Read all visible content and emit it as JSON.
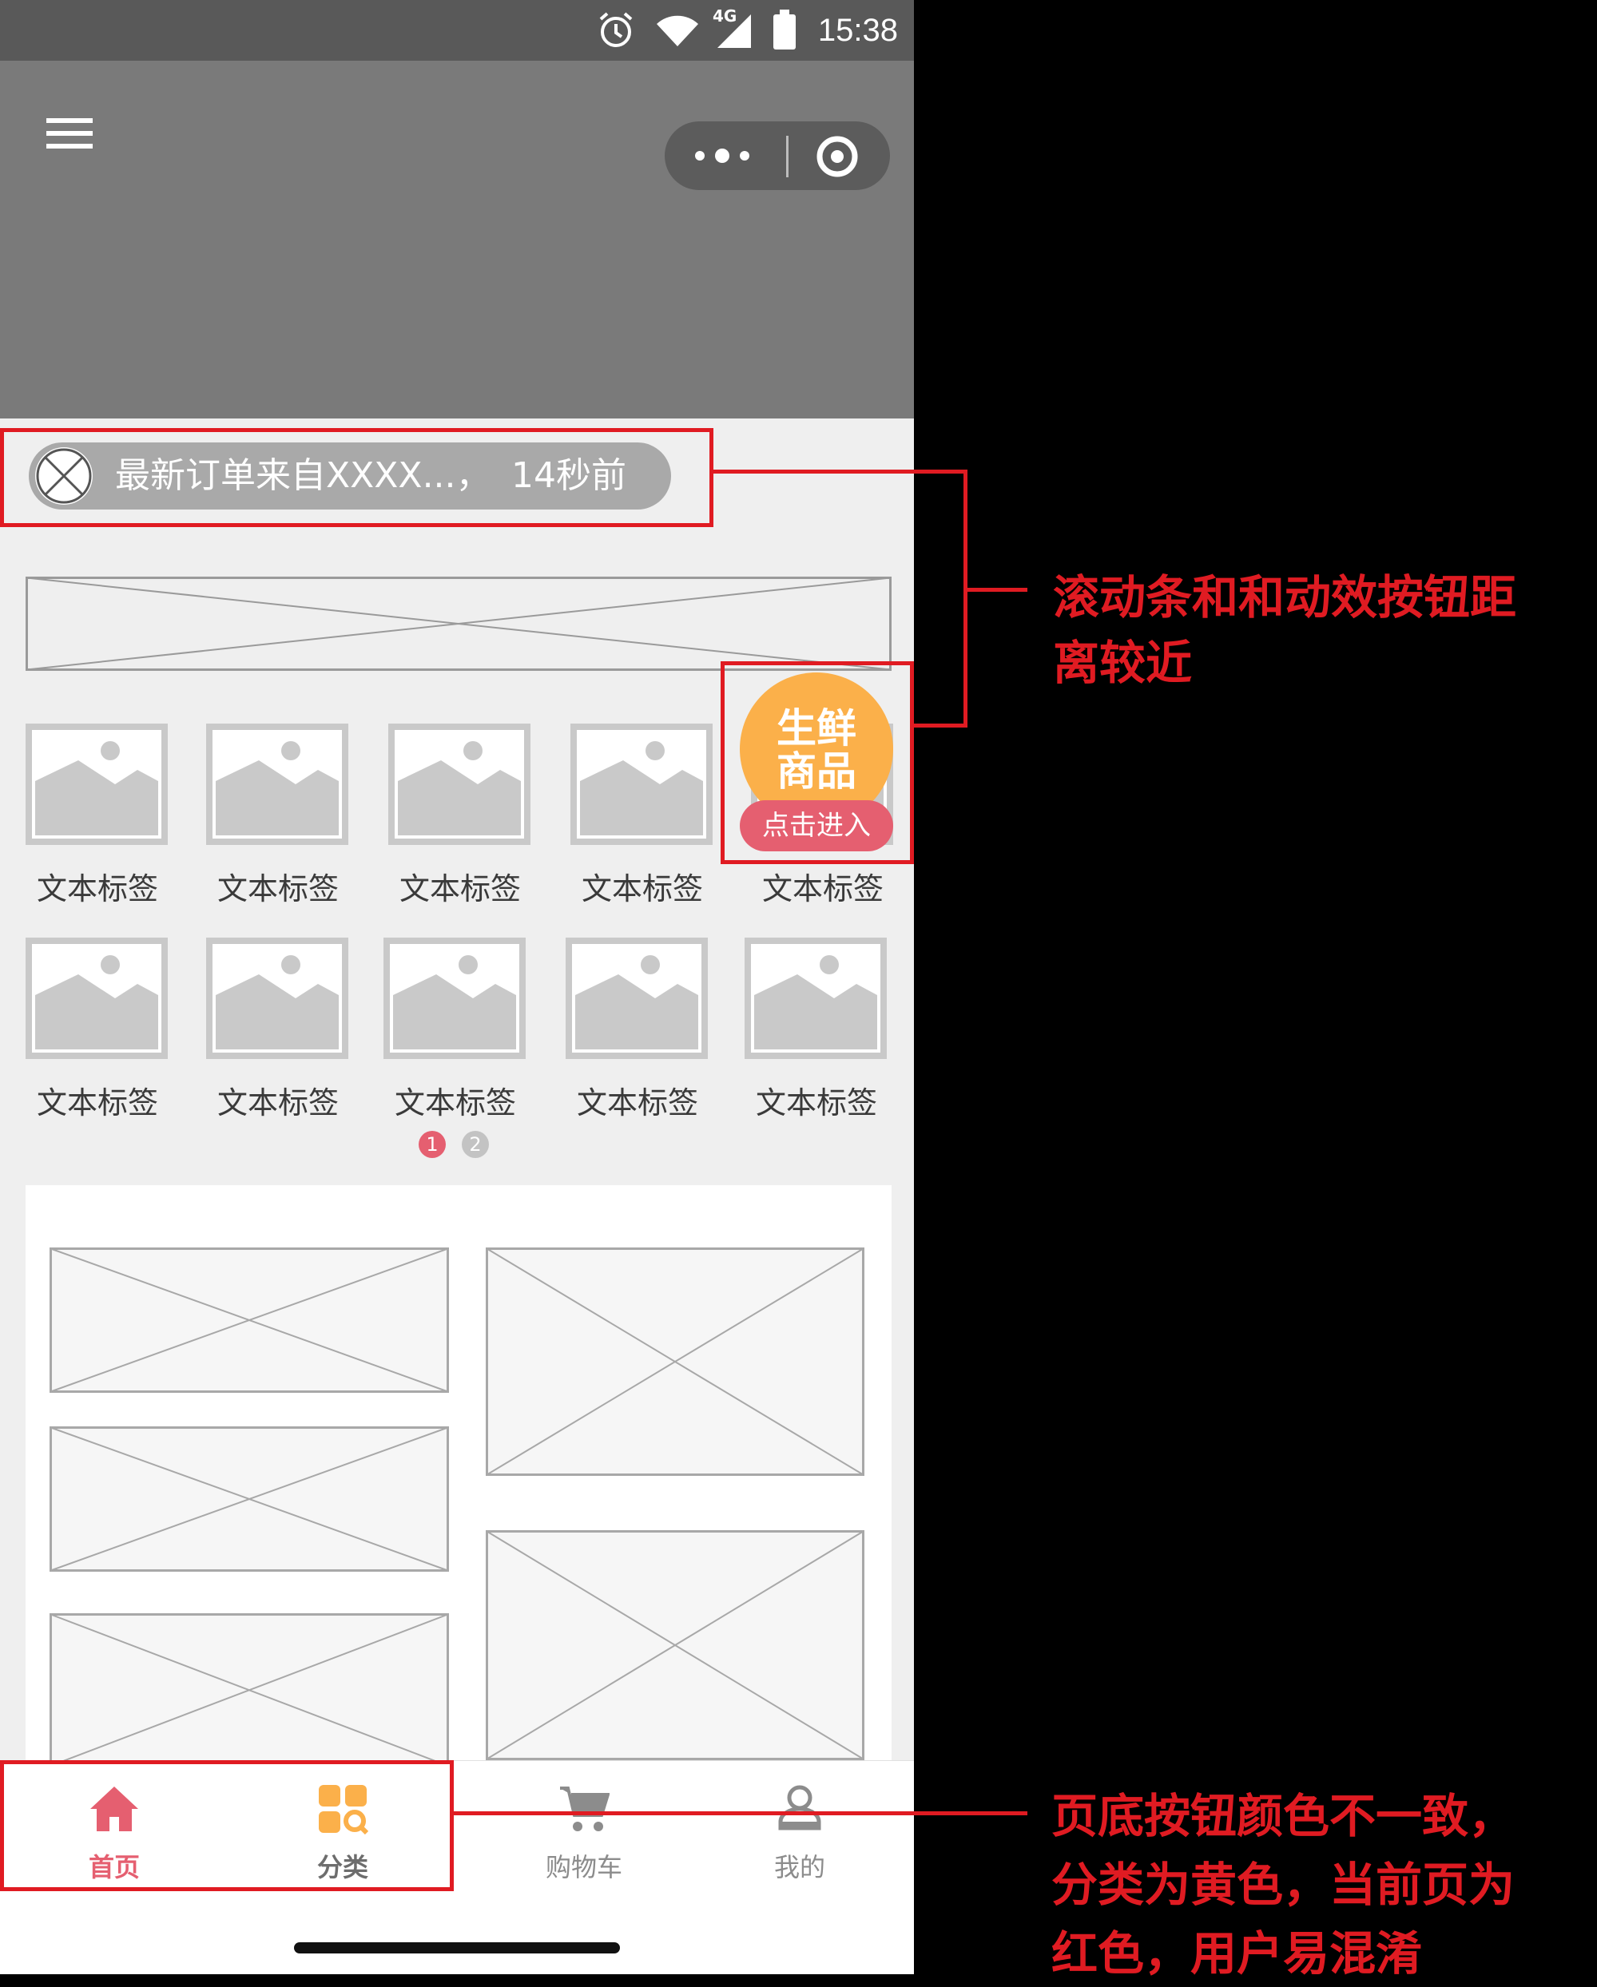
{
  "status_bar": {
    "time": "15:38",
    "network_label": "4G",
    "icons": [
      "alarm-icon",
      "wifi-icon",
      "signal-icon",
      "battery-icon"
    ]
  },
  "header": {
    "menu_icon": "hamburger-icon",
    "capsule_icons": [
      "more-dots-icon",
      "target-circle-icon"
    ]
  },
  "notice": {
    "text": "最新订单来自XXXX...，",
    "time": "14秒前"
  },
  "grid": {
    "row1": [
      "文本标签",
      "文本标签",
      "文本标签",
      "文本标签",
      "文本标签"
    ],
    "row2": [
      "文本标签",
      "文本标签",
      "文本标签",
      "文本标签",
      "文本标签"
    ]
  },
  "pagination": {
    "pages": [
      "1",
      "2"
    ],
    "current": "1"
  },
  "fab": {
    "title_line1": "生鲜",
    "title_line2": "商品",
    "enter_label": "点击进入"
  },
  "tabbar": {
    "tabs": [
      {
        "label": "首页",
        "icon": "home-icon",
        "color": "#e55f70"
      },
      {
        "label": "分类",
        "icon": "category-grid-icon",
        "color": "#fbb04a"
      },
      {
        "label": "购物车",
        "icon": "shopping-cart-icon",
        "color": "#8c8c8c"
      },
      {
        "label": "我的",
        "icon": "user-icon",
        "color": "#8c8c8c"
      }
    ]
  },
  "annotations": {
    "top": [
      "滚动条和和动效按钮距",
      "离较近"
    ],
    "bottom": [
      "页底按钮颜色不一致，",
      "分类为黄色，当前页为",
      "红色，用户易混淆"
    ]
  },
  "colors": {
    "annotation_red": "#e01b22",
    "fab_orange": "#fbb04a",
    "accent_pink": "#e55f70",
    "header_gray": "#7a7a7a"
  }
}
